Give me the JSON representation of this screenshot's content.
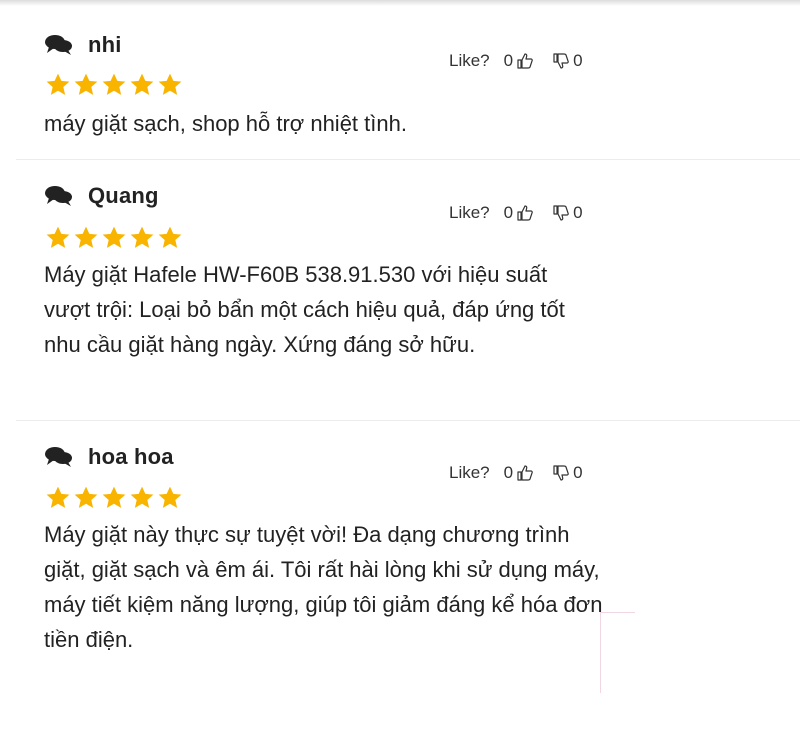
{
  "colors": {
    "star": "#f9b400",
    "text": "#222222",
    "divider": "#ececec"
  },
  "icons": {
    "author": "chat-bubbles-icon",
    "like": "thumbs-up-icon",
    "dislike": "thumbs-down-icon",
    "rating": "star-icon"
  },
  "reviews": [
    {
      "author": "nhi",
      "like_label": "Like?",
      "likes": "0",
      "dislikes": "0",
      "rating": 5,
      "content": "máy giặt sạch, shop hỗ trợ nhiệt tình."
    },
    {
      "author": "Quang",
      "like_label": "Like?",
      "likes": "0",
      "dislikes": "0",
      "rating": 5,
      "content": "Máy giặt Hafele HW-F60B 538.91.530 với hiệu suất vượt trội: Loại bỏ bẩn một cách hiệu quả, đáp ứng tốt nhu cầu giặt hàng ngày. Xứng đáng sở hữu."
    },
    {
      "author": "hoa hoa",
      "like_label": "Like?",
      "likes": "0",
      "dislikes": "0",
      "rating": 5,
      "content": "Máy giặt này thực sự tuyệt vời! Đa dạng chương trình giặt, giặt sạch và êm ái. Tôi rất hài lòng khi sử dụng máy, máy tiết kiệm năng lượng, giúp tôi giảm đáng kể hóa đơn tiền điện."
    }
  ]
}
